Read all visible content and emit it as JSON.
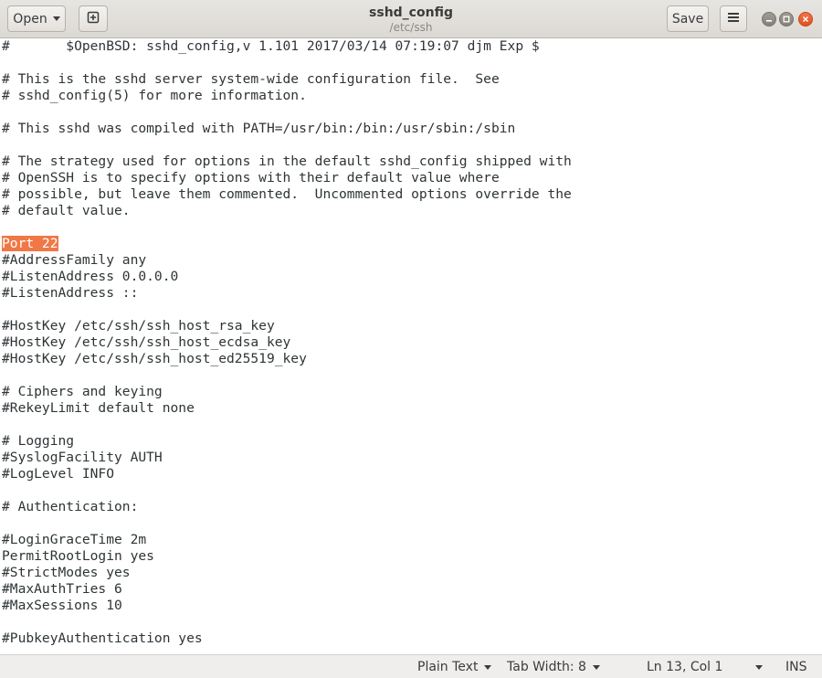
{
  "header": {
    "title": "sshd_config",
    "subtitle": "/etc/ssh",
    "open_label": "Open",
    "save_label": "Save",
    "icons": [
      "new-document-icon",
      "hamburger-menu-icon",
      "window-minimize-icon",
      "window-maximize-icon",
      "window-close-icon"
    ]
  },
  "editor": {
    "cursor": {
      "line": 13,
      "col": 1
    },
    "highlight_color": "#f07746",
    "lines": [
      "#\t$OpenBSD: sshd_config,v 1.101 2017/03/14 07:19:07 djm Exp $",
      "",
      "# This is the sshd server system-wide configuration file.  See",
      "# sshd_config(5) for more information.",
      "",
      "# This sshd was compiled with PATH=/usr/bin:/bin:/usr/sbin:/sbin",
      "",
      "# The strategy used for options in the default sshd_config shipped with",
      "# OpenSSH is to specify options with their default value where",
      "# possible, but leave them commented.  Uncommented options override the",
      "# default value.",
      "",
      "Port 22",
      "#AddressFamily any",
      "#ListenAddress 0.0.0.0",
      "#ListenAddress ::",
      "",
      "#HostKey /etc/ssh/ssh_host_rsa_key",
      "#HostKey /etc/ssh/ssh_host_ecdsa_key",
      "#HostKey /etc/ssh/ssh_host_ed25519_key",
      "",
      "# Ciphers and keying",
      "#RekeyLimit default none",
      "",
      "# Logging",
      "#SyslogFacility AUTH",
      "#LogLevel INFO",
      "",
      "# Authentication:",
      "",
      "#LoginGraceTime 2m",
      "PermitRootLogin yes",
      "#StrictModes yes",
      "#MaxAuthTries 6",
      "#MaxSessions 10",
      "",
      "#PubkeyAuthentication yes"
    ]
  },
  "statusbar": {
    "language": "Plain Text",
    "tab_width": "Tab Width: 8",
    "position": "Ln 13, Col 1",
    "mode": "INS"
  }
}
